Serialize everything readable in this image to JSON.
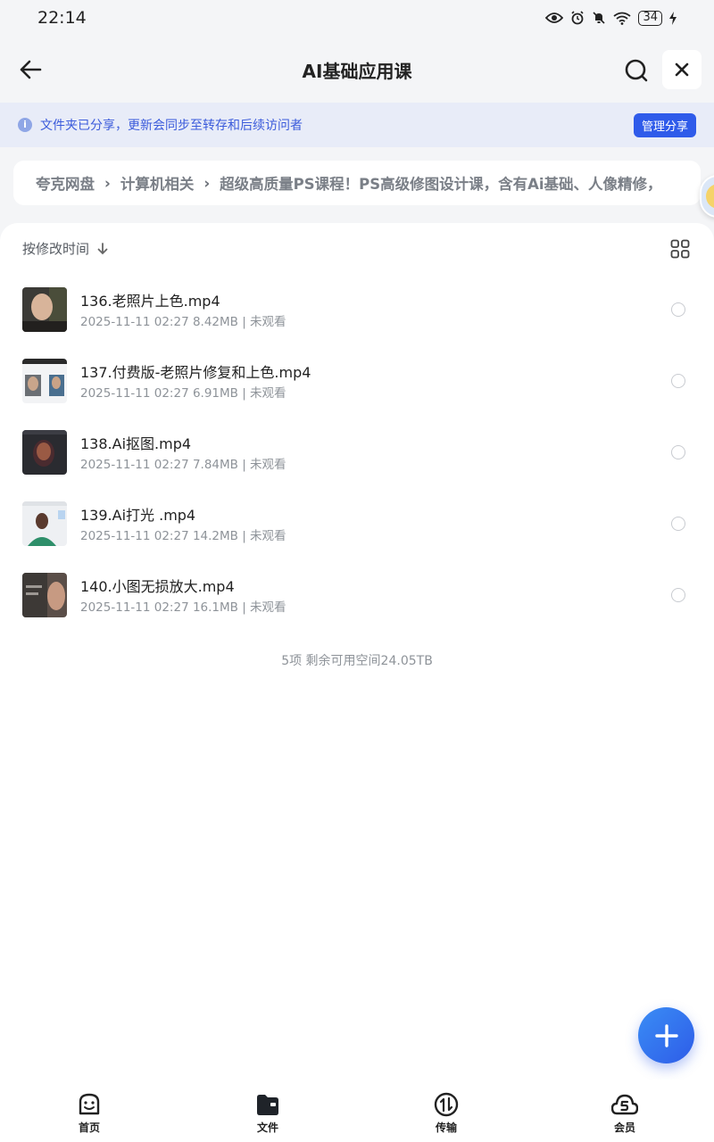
{
  "status_bar": {
    "time": "22:14",
    "battery": "34"
  },
  "nav": {
    "title": "AI基础应用课"
  },
  "banner": {
    "text": "文件夹已分享，更新会同步至转存和后续访问者",
    "manage_label": "管理分享"
  },
  "breadcrumb": {
    "items": [
      "夸克网盘",
      "计算机相关",
      "超级高质量PS课程！PS高级修图设计课，含有Ai基础、人像精修，"
    ]
  },
  "sort": {
    "label": "按修改时间"
  },
  "files": [
    {
      "name": "136.老照片上色.mp4",
      "meta": "2025-11-11 02:27  8.42MB | 未观看"
    },
    {
      "name": "137.付费版-老照片修复和上色.mp4",
      "meta": "2025-11-11 02:27  6.91MB | 未观看"
    },
    {
      "name": "138.Ai抠图.mp4",
      "meta": "2025-11-11 02:27  7.84MB | 未观看"
    },
    {
      "name": "139.Ai打光 .mp4",
      "meta": "2025-11-11 02:27  14.2MB | 未观看"
    },
    {
      "name": "140.小图无损放大.mp4",
      "meta": "2025-11-11 02:27  16.1MB | 未观看"
    }
  ],
  "summary": "5项  剩余可用空间24.05TB",
  "tabs": [
    {
      "label": "首页",
      "icon": "home-face-icon"
    },
    {
      "label": "文件",
      "icon": "folder-icon"
    },
    {
      "label": "传输",
      "icon": "transfer-icon"
    },
    {
      "label": "会员",
      "icon": "vip-cloud-icon"
    }
  ],
  "colors": {
    "accent": "#2f5bea",
    "banner_bg": "#e8ecf8",
    "banner_text": "#3b5bdb"
  }
}
